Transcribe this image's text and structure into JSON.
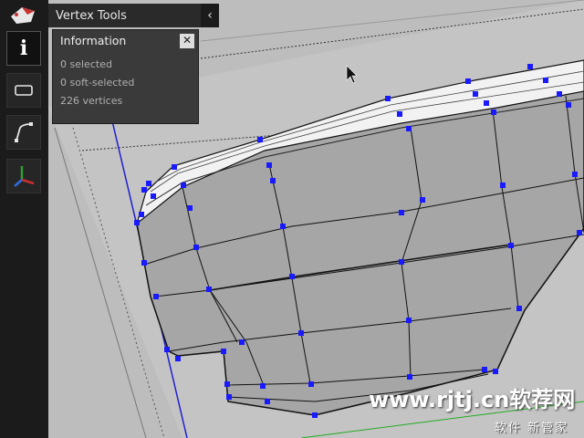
{
  "panel": {
    "title": "Vertex Tools",
    "collapse_glyph": "‹"
  },
  "toolbar": {
    "tools": [
      {
        "name": "info-tool",
        "icon": "info-icon",
        "label": "i"
      },
      {
        "name": "rectangle-select-tool",
        "icon": "rectangle-icon"
      },
      {
        "name": "soft-selection-tool",
        "icon": "curve-icon"
      },
      {
        "name": "axes-tool",
        "icon": "axes-icon"
      }
    ]
  },
  "information": {
    "title": "Information",
    "close_glyph": "✕",
    "selected": "0 selected",
    "soft_selected": "0 soft-selected",
    "vertices": "226 vertices"
  },
  "watermark": {
    "text": "www.rjtj.cn软荐网",
    "sub": "软件 新管家"
  },
  "colors": {
    "vertex": "#1a1aff",
    "toolbar_bg": "#1b1b1b",
    "panel_bg": "#3a3a3a",
    "viewport_bg": "#bdbdbd",
    "axis_blue": "#1f1fd0",
    "axis_green": "#22aa22"
  }
}
